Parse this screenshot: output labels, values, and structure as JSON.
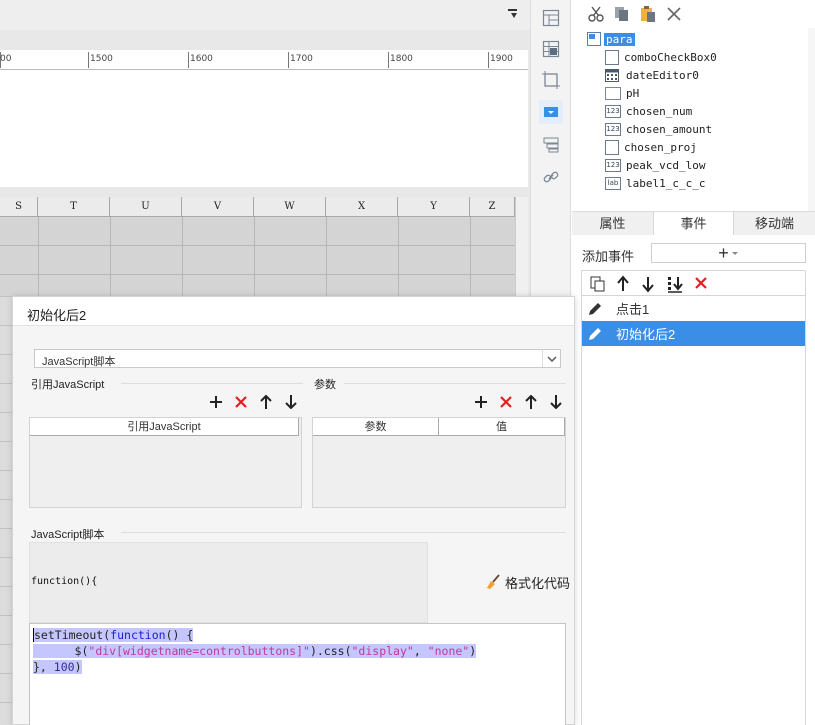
{
  "canvas": {
    "ruler_labels": [
      "00",
      "1500",
      "1600",
      "1700",
      "1800",
      "1900"
    ],
    "columns": [
      "S",
      "T",
      "U",
      "V",
      "W",
      "X",
      "Y",
      "Z"
    ]
  },
  "vertical_toolbar": {
    "icons": [
      "frozen-layout-icon",
      "grid-table-icon",
      "crop-frame-icon",
      "dropdown-widget-icon",
      "print-layout-icon",
      "link-icon"
    ]
  },
  "widget_tree": {
    "toolbar_icons": [
      "cut-icon",
      "copy-icon",
      "paste-icon",
      "delete-icon"
    ],
    "root": "para",
    "nodes": [
      {
        "label": "comboCheckBox0",
        "icon": "combo-icon"
      },
      {
        "label": "dateEditor0",
        "icon": "calendar-icon"
      },
      {
        "label": "pH",
        "icon": "textbox-icon"
      },
      {
        "label": "chosen_num",
        "icon": "number-icon",
        "icon_text": "123"
      },
      {
        "label": "chosen_amount",
        "icon": "number-icon",
        "icon_text": "123"
      },
      {
        "label": "chosen_proj",
        "icon": "combo-icon"
      },
      {
        "label": "peak_vcd_low",
        "icon": "number-icon",
        "icon_text": "123"
      },
      {
        "label": "label1_c_c_c",
        "icon": "label-icon",
        "icon_text": "lab"
      }
    ]
  },
  "tabs": [
    "属性",
    "事件",
    "移动端"
  ],
  "active_tab": "事件",
  "events": {
    "add_label": "添加事件",
    "add_symbol": "+",
    "items": [
      {
        "label": "点击1",
        "selected": false
      },
      {
        "label": "初始化后2",
        "selected": true
      }
    ]
  },
  "dialog": {
    "title": "初始化后2",
    "type_value": "JavaScript脚本",
    "ref_section_label": "引用JavaScript",
    "param_section_label": "参数",
    "ref_table_header": "引用JavaScript",
    "param_table_headers": [
      "参数",
      "值"
    ],
    "script_section_label": "JavaScript脚本",
    "code_prefix": "function(){",
    "format_label": "格式化代码",
    "code": {
      "line1_a": "setTimeout(",
      "line1_kw": "function",
      "line1_b": "() {",
      "line2_a": "      $(",
      "line2_str": "\"div[widgetname=controlbuttons]\"",
      "line2_b": ").css(",
      "line2_str2": "\"display\"",
      "line2_c": ", ",
      "line2_str3": "\"none\"",
      "line2_d": ")",
      "line3_a": "}, ",
      "line3_num": "100",
      "line3_b": ")"
    }
  },
  "colors": {
    "selection_blue": "#3a8ee6",
    "delete_red": "#e02020",
    "code_highlight": "#c6c6ff"
  }
}
